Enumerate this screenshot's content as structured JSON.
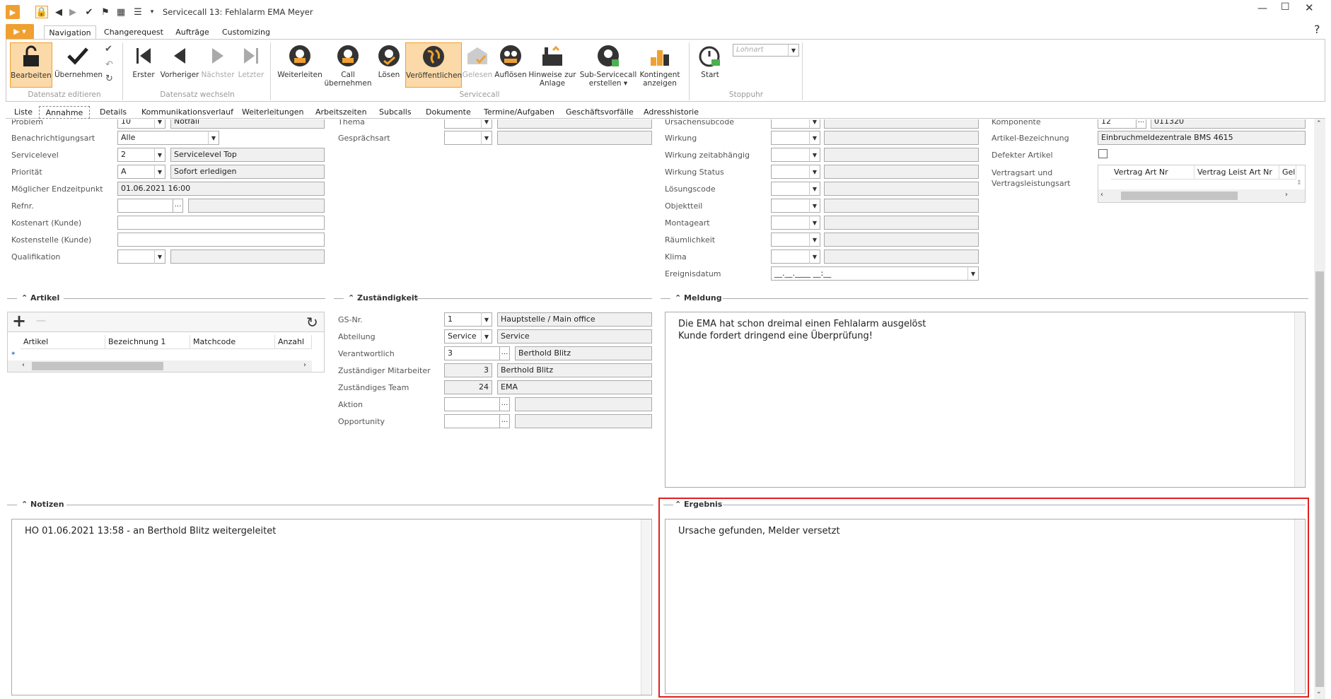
{
  "window": {
    "title": "Servicecall 13: Fehlalarm EMA Meyer",
    "help": "?"
  },
  "ribbon_tabs": [
    "Navigation",
    "Changerequest",
    "Aufträge",
    "Customizing"
  ],
  "ribbon": {
    "edit": {
      "bearbeiten": "Bearbeiten",
      "uebernehmen": "Übernehmen",
      "group": "Datensatz editieren"
    },
    "nav": {
      "erster": "Erster",
      "vorheriger": "Vorheriger",
      "naechster": "Nächster",
      "letzter": "Letzter",
      "group": "Datensatz wechseln"
    },
    "sc": {
      "weiterleiten": "Weiterleiten",
      "call1": "Call",
      "call2": "übernehmen",
      "loesen": "Lösen",
      "veroeffentlichen": "Veröffentlichen",
      "gelesen": "Gelesen",
      "aufloesen": "Auflösen",
      "hinweise1": "Hinweise zur",
      "hinweise2": "Anlage",
      "sub1": "Sub-Servicecall",
      "sub2": "erstellen ▾",
      "kont1": "Kontingent",
      "kont2": "anzeigen",
      "group": "Servicecall"
    },
    "stopp": {
      "start": "Start",
      "lohnart": "Lohnart",
      "group": "Stoppuhr"
    }
  },
  "subtabs": [
    "Liste",
    "Annahme",
    "Details",
    "Kommunikationsverlauf",
    "Weiterleitungen",
    "Arbeitszeiten",
    "Subcalls",
    "Dokumente",
    "Termine/Aufgaben",
    "Geschäftsvorfälle",
    "Adresshistorie"
  ],
  "col1": {
    "problem": {
      "label": "Problem",
      "code": "10",
      "text": "Notfall"
    },
    "benachrichtigungsart": {
      "label": "Benachrichtigungsart",
      "value": "Alle"
    },
    "servicelevel": {
      "label": "Servicelevel",
      "code": "2",
      "text": "Servicelevel Top"
    },
    "prioritaet": {
      "label": "Priorität",
      "code": "A",
      "text": "Sofort erledigen"
    },
    "endzeitpunkt": {
      "label": "Möglicher Endzeitpunkt",
      "value": "01.06.2021 16:00"
    },
    "refnr": {
      "label": "Refnr."
    },
    "kostenart": {
      "label": "Kostenart (Kunde)"
    },
    "kostenstelle": {
      "label": "Kostenstelle (Kunde)"
    },
    "qualifikation": {
      "label": "Qualifikation"
    }
  },
  "col2": {
    "thema": "Thema",
    "gespraechsart": "Gesprächsart"
  },
  "col3": {
    "ursachensubcode": "Ursachensubcode",
    "wirkung": "Wirkung",
    "wirkung_zeit": "Wirkung zeitabhängig",
    "wirkung_status": "Wirkung Status",
    "loesungscode": "Lösungscode",
    "objektteil": "Objektteil",
    "montageart": "Montageart",
    "raeumlichkeit": "Räumlichkeit",
    "klima": "Klima",
    "ereignisdatum": "Ereignisdatum",
    "ereignisdatum_mask": "__.__.____ __:__"
  },
  "col4": {
    "komponente": {
      "label": "Komponente",
      "code": "12",
      "text": "011320"
    },
    "artikel_bez": {
      "label": "Artikel-Bezeichnung",
      "value": "Einbruchmeldezentrale BMS 4615"
    },
    "defekt": {
      "label": "Defekter Artikel"
    },
    "vertragsart1": "Vertragsart und",
    "vertragsart2": "Vertragsleistungsart",
    "grid_cols": [
      "Vertrag Art Nr",
      "Vertrag Leist Art Nr",
      "Gel"
    ]
  },
  "artikel": {
    "title": "Artikel",
    "cols": [
      "Artikel",
      "Bezeichnung 1",
      "Matchcode",
      "Anzahl"
    ],
    "add": "+",
    "remove": "—"
  },
  "zust": {
    "title": "Zuständigkeit",
    "gs": {
      "label": "GS-Nr.",
      "code": "1",
      "text": "Hauptstelle / Main office"
    },
    "abteilung": {
      "label": "Abteilung",
      "code": "Service",
      "text": "Service"
    },
    "verantwortlich": {
      "label": "Verantwortlich",
      "code": "3",
      "text": "Berthold Blitz"
    },
    "mitarbeiter": {
      "label": "Zuständiger Mitarbeiter",
      "code": "3",
      "text": "Berthold Blitz"
    },
    "team": {
      "label": "Zuständiges Team",
      "code": "24",
      "text": "EMA"
    },
    "aktion": {
      "label": "Aktion"
    },
    "opportunity": {
      "label": "Opportunity"
    }
  },
  "meldung": {
    "title": "Meldung",
    "text": "Die EMA hat schon dreimal einen Fehlalarm ausgelöst\nKunde fordert dringend eine Überprüfung!"
  },
  "notizen": {
    "title": "Notizen",
    "text": "HO 01.06.2021 13:58 - an Berthold Blitz weitergeleitet"
  },
  "ergebnis": {
    "title": "Ergebnis",
    "text": "Ursache gefunden, Melder versetzt"
  },
  "colors": {
    "accent": "#f0a030",
    "highlight": "#e02020"
  }
}
